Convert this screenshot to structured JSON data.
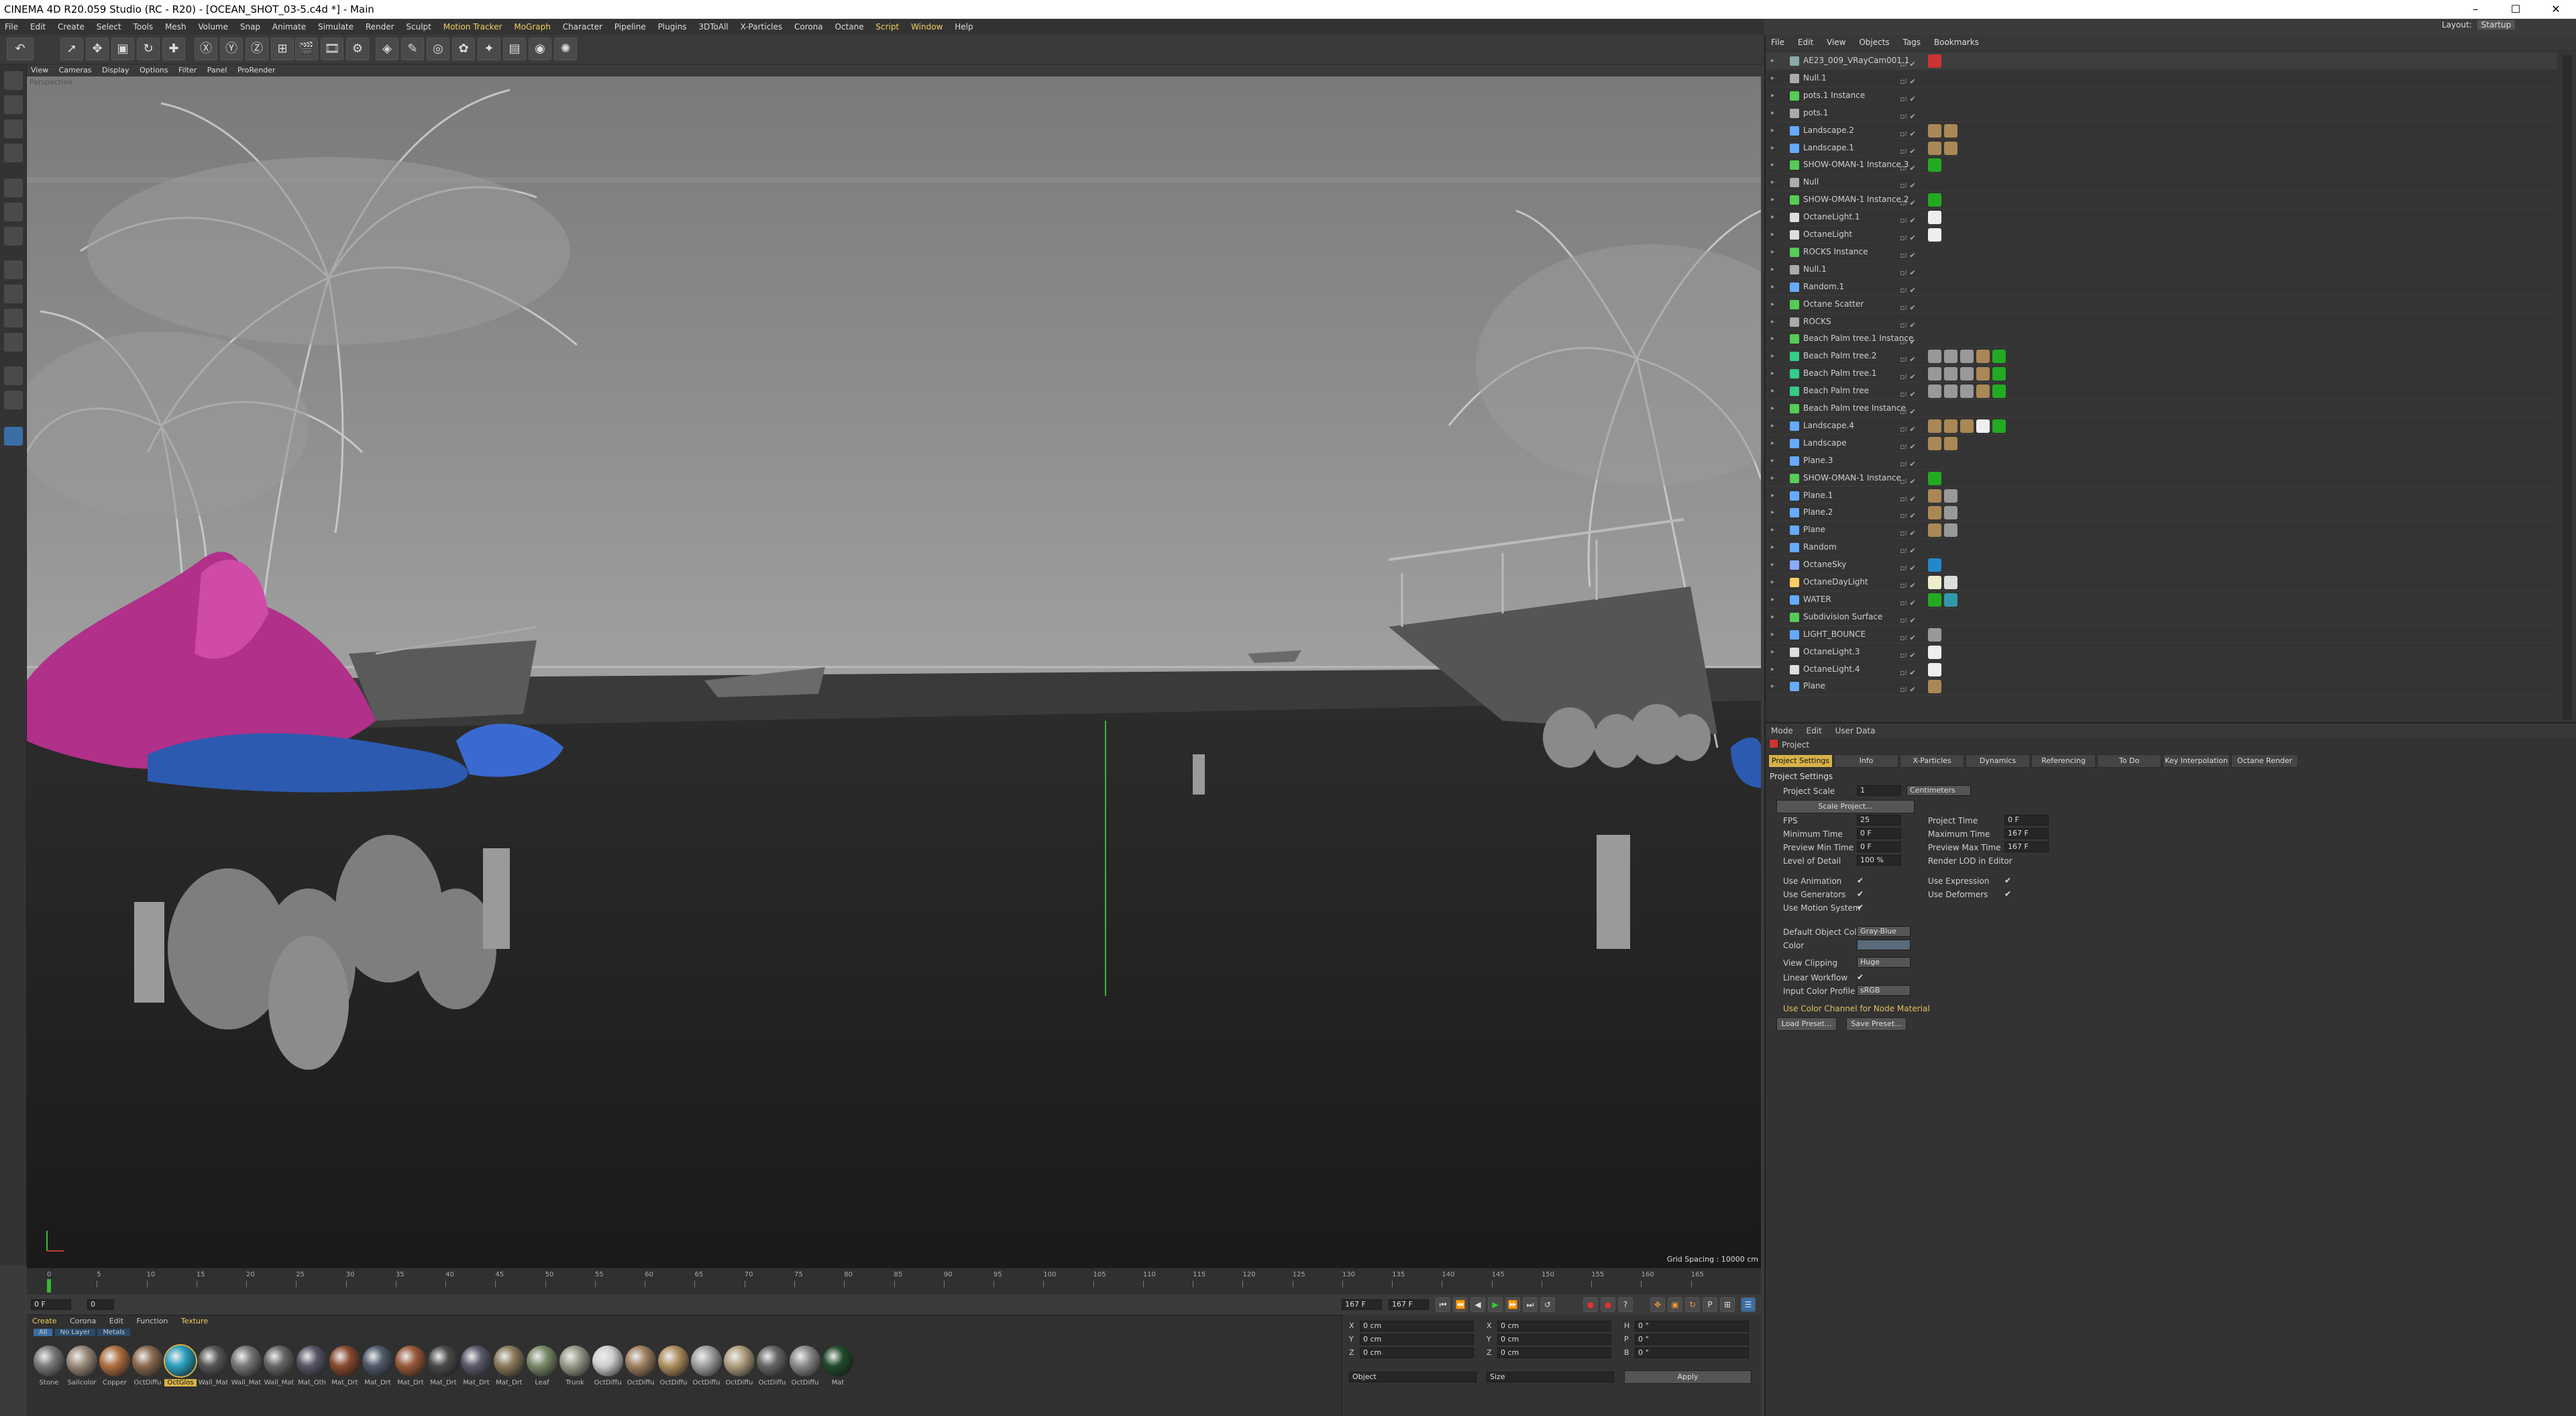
{
  "window": {
    "title": "CINEMA 4D R20.059 Studio (RC - R20) - [OCEAN_SHOT_03-5.c4d *] - Main",
    "minimize": "–",
    "maximize": "☐",
    "close": "✕"
  },
  "menubar": [
    "File",
    "Edit",
    "Create",
    "Select",
    "Tools",
    "Mesh",
    "Volume",
    "Snap",
    "Animate",
    "Simulate",
    "Render",
    "Sculpt",
    "Motion Tracker",
    "MoGraph",
    "Character",
    "Pipeline",
    "Plugins",
    "3DToAll",
    "X-Particles",
    "Corona",
    "Octane",
    "Script",
    "Window",
    "Help"
  ],
  "layout": {
    "label": "Layout:",
    "value": "Startup"
  },
  "viewport": {
    "menu": [
      "View",
      "Cameras",
      "Display",
      "Options",
      "Filter",
      "Panel",
      "ProRender"
    ],
    "grid_spacing": "Grid Spacing : 10000 cm",
    "label": "Perspective"
  },
  "timeline": {
    "ticks": [
      "0",
      "5",
      "10",
      "15",
      "20",
      "25",
      "30",
      "35",
      "40",
      "45",
      "50",
      "55",
      "60",
      "65",
      "70",
      "75",
      "80",
      "85",
      "90",
      "95",
      "100",
      "105",
      "110",
      "115",
      "120",
      "125",
      "130",
      "135",
      "140",
      "145",
      "150",
      "155",
      "160",
      "165"
    ],
    "current": "0 F",
    "end": "167 F",
    "end2": "167 F",
    "field_a": "0 F",
    "field_b": "0"
  },
  "materials": {
    "menu": [
      "Create",
      "Corona",
      "Edit",
      "Function",
      "Texture"
    ],
    "filters": [
      "All",
      "No Layer",
      "Metals"
    ],
    "items": [
      {
        "label": "Stone",
        "color": "#7a7a7a"
      },
      {
        "label": "Sailcolor",
        "color": "#9a8a7a"
      },
      {
        "label": "Copper",
        "color": "#b07040"
      },
      {
        "label": "OctDiffu",
        "color": "#8a6a50"
      },
      {
        "label": "OctGlos",
        "color": "#2aa0c0"
      },
      {
        "label": "Wall_Mat",
        "color": "#555"
      },
      {
        "label": "Wall_Mat",
        "color": "#777"
      },
      {
        "label": "Wall_Mat",
        "color": "#666"
      },
      {
        "label": "Mat_Oth",
        "color": "#555566"
      },
      {
        "label": "Mat_Drt",
        "color": "#8a4a30"
      },
      {
        "label": "Mat_Drt",
        "color": "#505a6a"
      },
      {
        "label": "Mat_Drt",
        "color": "#9a5a3a"
      },
      {
        "label": "Mat_Drt",
        "color": "#4a4a4a"
      },
      {
        "label": "Mat_Drt",
        "color": "#5a5a6a"
      },
      {
        "label": "Mat_Drt",
        "color": "#8a7a5a"
      },
      {
        "label": "Leaf",
        "color": "#7a8a6a"
      },
      {
        "label": "Trunk",
        "color": "#9a9a8a"
      },
      {
        "label": "OctDiffu",
        "color": "#cfcfcf"
      },
      {
        "label": "OctDiffu",
        "color": "#a08060"
      },
      {
        "label": "OctDiffu",
        "color": "#b09060"
      },
      {
        "label": "OctDiffu",
        "color": "#a0a0a0"
      },
      {
        "label": "OctDiffu",
        "color": "#b0a080"
      },
      {
        "label": "OctDiffu",
        "color": "#666"
      },
      {
        "label": "OctDiffu",
        "color": "#8a8a8a"
      },
      {
        "label": "Mat",
        "color": "#224a2a"
      }
    ]
  },
  "coords": {
    "rows": [
      {
        "a": "X",
        "av": "0 cm",
        "b": "X",
        "bv": "0 cm",
        "c": "H",
        "cv": "0 °"
      },
      {
        "a": "Y",
        "av": "0 cm",
        "b": "Y",
        "bv": "0 cm",
        "c": "P",
        "cv": "0 °"
      },
      {
        "a": "Z",
        "av": "0 cm",
        "b": "Z",
        "bv": "0 cm",
        "c": "B",
        "cv": "0 °"
      }
    ],
    "mode1": "Object",
    "mode2": "Size",
    "apply": "Apply"
  },
  "objects": {
    "menu": [
      "File",
      "Edit",
      "View",
      "Objects",
      "Tags",
      "Bookmarks"
    ],
    "items": [
      {
        "name": "AE23_009_VRayCam001.1",
        "color": "#8aa",
        "tags": [
          "#c33"
        ]
      },
      {
        "name": "Null.1",
        "color": "#aaa",
        "tags": []
      },
      {
        "name": "pots.1 Instance",
        "color": "#5c5",
        "tags": []
      },
      {
        "name": "pots.1",
        "color": "#aaa",
        "tags": []
      },
      {
        "name": "Landscape.2",
        "color": "#6af",
        "tags": [
          "#a85",
          "#a85"
        ]
      },
      {
        "name": "Landscape.1",
        "color": "#6af",
        "tags": [
          "#a85",
          "#a85"
        ]
      },
      {
        "name": "SHOW-OMAN-1 Instance.3",
        "color": "#5c5",
        "tags": [
          "#2a2"
        ]
      },
      {
        "name": "Null",
        "color": "#aaa",
        "tags": []
      },
      {
        "name": "SHOW-OMAN-1 Instance.2",
        "color": "#5c5",
        "tags": [
          "#2a2"
        ]
      },
      {
        "name": "OctaneLight.1",
        "color": "#ddd",
        "tags": [
          "#eee"
        ]
      },
      {
        "name": "OctaneLight",
        "color": "#ddd",
        "tags": [
          "#eee"
        ]
      },
      {
        "name": "ROCKS Instance",
        "color": "#5c5",
        "tags": []
      },
      {
        "name": "Null.1",
        "color": "#aaa",
        "tags": []
      },
      {
        "name": "Random.1",
        "color": "#6af",
        "tags": []
      },
      {
        "name": "Octane Scatter",
        "color": "#5c5",
        "tags": []
      },
      {
        "name": "ROCKS",
        "color": "#aaa",
        "tags": []
      },
      {
        "name": "Beach Palm tree.1 Instance",
        "color": "#5c5",
        "tags": []
      },
      {
        "name": "Beach Palm tree.2",
        "color": "#3c8",
        "tags": [
          "#999",
          "#999",
          "#999",
          "#a85",
          "#2a2"
        ]
      },
      {
        "name": "Beach Palm tree.1",
        "color": "#3c8",
        "tags": [
          "#999",
          "#999",
          "#999",
          "#a85",
          "#2a2"
        ]
      },
      {
        "name": "Beach Palm tree",
        "color": "#3c8",
        "tags": [
          "#999",
          "#999",
          "#999",
          "#a85",
          "#2a2"
        ]
      },
      {
        "name": "Beach Palm tree Instance",
        "color": "#5c5",
        "tags": []
      },
      {
        "name": "Landscape.4",
        "color": "#6af",
        "tags": [
          "#a85",
          "#a85",
          "#a85",
          "#eee",
          "#2a2"
        ]
      },
      {
        "name": "Landscape",
        "color": "#6af",
        "tags": [
          "#a85",
          "#a85"
        ]
      },
      {
        "name": "Plane.3",
        "color": "#6af",
        "tags": []
      },
      {
        "name": "SHOW-OMAN-1 Instance",
        "color": "#5c5",
        "tags": [
          "#2a2"
        ]
      },
      {
        "name": "Plane.1",
        "color": "#6af",
        "tags": [
          "#a85",
          "#999"
        ]
      },
      {
        "name": "Plane.2",
        "color": "#6af",
        "tags": [
          "#a85",
          "#999"
        ]
      },
      {
        "name": "Plane",
        "color": "#6af",
        "tags": [
          "#a85",
          "#999"
        ]
      },
      {
        "name": "Random",
        "color": "#6af",
        "tags": []
      },
      {
        "name": "OctaneSky",
        "color": "#8af",
        "tags": [
          "#28c"
        ]
      },
      {
        "name": "OctaneDayLight",
        "color": "#fc6",
        "tags": [
          "#eec",
          "#ddd"
        ]
      },
      {
        "name": "WATER",
        "color": "#6af",
        "tags": [
          "#2a2",
          "#39a"
        ]
      },
      {
        "name": "Subdivision Surface",
        "color": "#5c5",
        "tags": []
      },
      {
        "name": "LIGHT_BOUNCE",
        "color": "#6af",
        "tags": [
          "#999"
        ]
      },
      {
        "name": "OctaneLight.3",
        "color": "#ddd",
        "tags": [
          "#eee"
        ]
      },
      {
        "name": "OctaneLight.4",
        "color": "#ddd",
        "tags": [
          "#eee"
        ]
      },
      {
        "name": "Plane",
        "color": "#6af",
        "tags": [
          "#a85"
        ]
      }
    ]
  },
  "attributes": {
    "menu": [
      "Mode",
      "Edit",
      "User Data"
    ],
    "header": "Project",
    "tabs": [
      "Project Settings",
      "Info",
      "X-Particles",
      "Dynamics",
      "Referencing",
      "To Do",
      "Key Interpolation",
      "Octane Render"
    ],
    "section": "Project Settings",
    "project_scale_label": "Project Scale",
    "project_scale_value": "1",
    "project_scale_unit": "Centimeters",
    "scale_button": "Scale Project...",
    "left": [
      {
        "label": "FPS",
        "value": "25"
      },
      {
        "label": "Minimum Time",
        "value": "0 F"
      },
      {
        "label": "Preview Min Time",
        "value": "0 F"
      },
      {
        "label": "Level of Detail",
        "value": "100 %"
      }
    ],
    "right": [
      {
        "label": "Project Time",
        "value": "0 F"
      },
      {
        "label": "Maximum Time",
        "value": "167 F"
      },
      {
        "label": "Preview Max Time",
        "value": "167 F"
      },
      {
        "label": "Render LOD in Editor",
        "value": ""
      }
    ],
    "checks_left": [
      "Use Animation",
      "Use Generators",
      "Use Motion System"
    ],
    "checks_right": [
      "Use Expression",
      "Use Deformers"
    ],
    "default_color_label": "Default Object Color",
    "default_color_value": "Gray-Blue",
    "color_label": "Color",
    "view_clipping_label": "View Clipping",
    "view_clipping_value": "Huge",
    "linear_label": "Linear Workflow",
    "input_profile_label": "Input Color Profile",
    "input_profile_value": "sRGB",
    "node_label": "Use Color Channel for Node Material",
    "load_preset": "Load Preset...",
    "save_preset": "Save Preset...",
    "check": "✔"
  }
}
